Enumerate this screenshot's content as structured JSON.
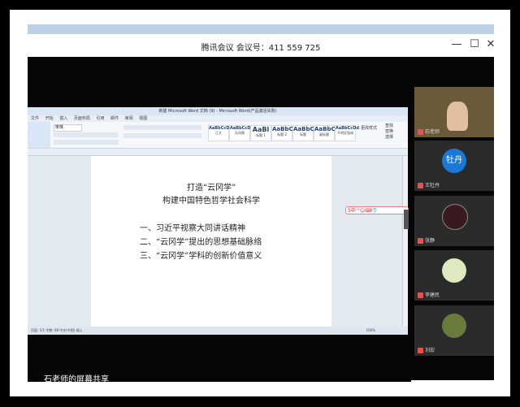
{
  "meeting": {
    "title": "腾讯会议 会议号：411 559 725",
    "share_status": "石老师的屏幕共享"
  },
  "window_controls": {
    "minimize": "—",
    "restore": "☐",
    "close": "✕"
  },
  "word": {
    "window_title": "新建 Microsoft Word 文档 (9) - Microsoft Word(产品激活失败)",
    "tabs": [
      "文件",
      "开始",
      "插入",
      "页面布局",
      "引用",
      "邮件",
      "审阅",
      "视图"
    ],
    "font_name": "宋体",
    "styles": [
      {
        "sample": "AaBbCcDd",
        "name": "正文"
      },
      {
        "sample": "AaBbCcDd",
        "name": "无间隔"
      },
      {
        "sample": "AaBl",
        "name": "标题 1"
      },
      {
        "sample": "AaBbC",
        "name": "标题 2"
      },
      {
        "sample": "AaBbC",
        "name": "标题"
      },
      {
        "sample": "AaBbC",
        "name": "副标题"
      },
      {
        "sample": "AaBbCcDd",
        "name": "不明显强调"
      }
    ],
    "right_tools": [
      "查找",
      "替换",
      "选择"
    ],
    "change_styles": "更改样式",
    "status": "页面: 1/1  字数: 68  中文(中国)  插入",
    "zoom": "100%",
    "document": {
      "title1": "打造“云冈学”",
      "title2": "构建中国特色哲学社会科学",
      "items": [
        "一、习近平视察大同讲话精神",
        "二、“云冈学”提出的思想基础脉络",
        "三、“云冈学”学科的创新价值意义"
      ]
    },
    "ime": "S中·°☺⌨👕"
  },
  "participants": [
    {
      "name": "石老师",
      "avatar_text": "",
      "color": "#556b4a"
    },
    {
      "name": "王牡丹",
      "avatar_text": "牡丹",
      "color": "#1a78d6"
    },
    {
      "name": "张静",
      "avatar_text": "",
      "color": "#3a1a22"
    },
    {
      "name": "李建民",
      "avatar_text": "",
      "color": "#b8c98a"
    },
    {
      "name": "刘宏",
      "avatar_text": "",
      "color": "#6a7a3a"
    }
  ]
}
